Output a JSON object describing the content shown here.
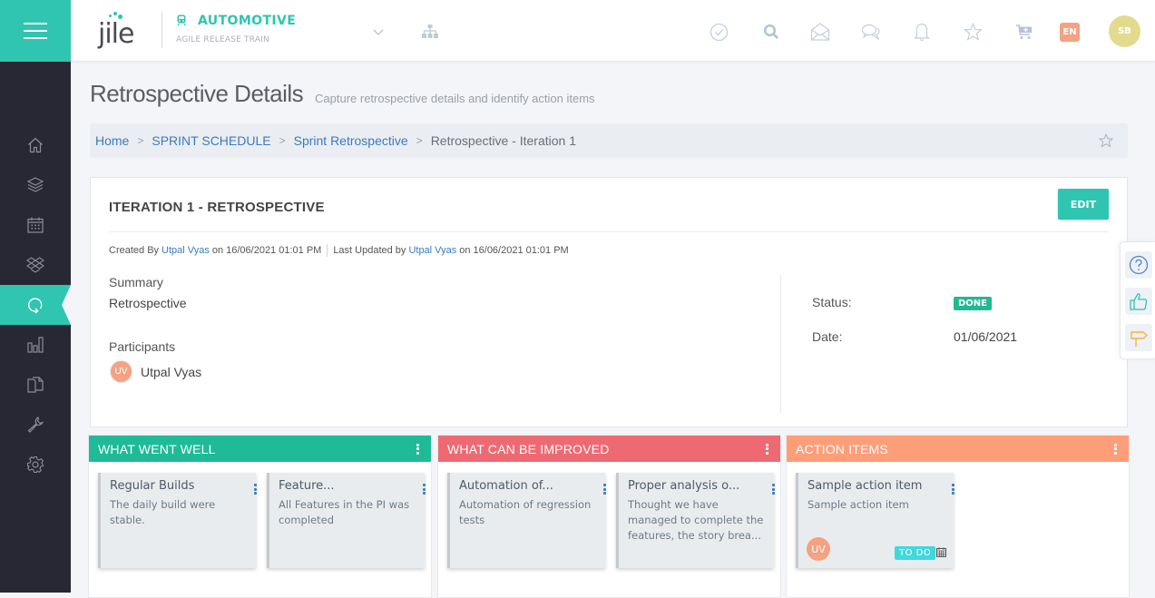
{
  "header": {
    "logo_text": "jile",
    "project_name": "AUTOMOTIVE",
    "project_subtitle": "AGILE RELEASE TRAIN",
    "icons": [
      "check-circle-icon",
      "search-icon",
      "mail-open-icon",
      "chat-icon",
      "bell-icon",
      "star-icon",
      "cart-icon"
    ],
    "language": "EN",
    "user_initials": "SB",
    "brand_color": "#2fc5b0"
  },
  "sidebar": {
    "items": [
      {
        "name": "home",
        "active": false
      },
      {
        "name": "layers",
        "active": false
      },
      {
        "name": "calendar",
        "active": false
      },
      {
        "name": "boxes",
        "active": false
      },
      {
        "name": "retrospective",
        "active": true
      },
      {
        "name": "reports",
        "active": false
      },
      {
        "name": "documents",
        "active": false
      },
      {
        "name": "tools",
        "active": false
      },
      {
        "name": "settings",
        "active": false
      }
    ]
  },
  "page": {
    "title": "Retrospective Details",
    "subtitle": "Capture retrospective details and identify action items"
  },
  "breadcrumb": {
    "items": [
      {
        "label": "Home",
        "link": true
      },
      {
        "label": "SPRINT SCHEDULE",
        "link": true
      },
      {
        "label": "Sprint Retrospective",
        "link": true
      },
      {
        "label": "Retrospective - Iteration 1",
        "link": false
      }
    ]
  },
  "detail": {
    "title": "ITERATION 1 - RETROSPECTIVE",
    "edit_label": "EDIT",
    "created_prefix": "Created By",
    "created_by": "Utpal Vyas",
    "created_on": "on 16/06/2021 01:01 PM",
    "updated_prefix": "Last Updated by",
    "updated_by": "Utpal Vyas",
    "updated_on": "on 16/06/2021 01:01 PM",
    "summary_label": "Summary",
    "summary_value": "Retrospective",
    "participants_label": "Participants",
    "participants": [
      {
        "initials": "UV",
        "name": "Utpal Vyas"
      }
    ],
    "status_label": "Status:",
    "status_value": "DONE",
    "date_label": "Date:",
    "date_value": "01/06/2021"
  },
  "float_panel": {
    "buttons": [
      "help-icon",
      "thumbs-up-icon",
      "signpost-icon"
    ]
  },
  "board": {
    "columns": [
      {
        "title": "WHAT WENT WELL",
        "color": "#1fbb98",
        "notes": [
          {
            "title": "Regular Builds",
            "body": "The daily build were stable."
          },
          {
            "title": "Feature...",
            "body": "All Features in the PI was completed"
          }
        ]
      },
      {
        "title": "WHAT CAN BE IMPROVED",
        "color": "#ee6a73",
        "notes": [
          {
            "title": "Automation of...",
            "body": "Automation of regression tests"
          },
          {
            "title": "Proper analysis o...",
            "body": "Thought we have managed to complete the features, the story brea..."
          }
        ]
      },
      {
        "title": "ACTION ITEMS",
        "color": "#fd9e79",
        "notes": [
          {
            "title": "Sample action item",
            "body": "Sample action item",
            "assignee": "UV",
            "status": "TO DO"
          }
        ]
      }
    ]
  }
}
